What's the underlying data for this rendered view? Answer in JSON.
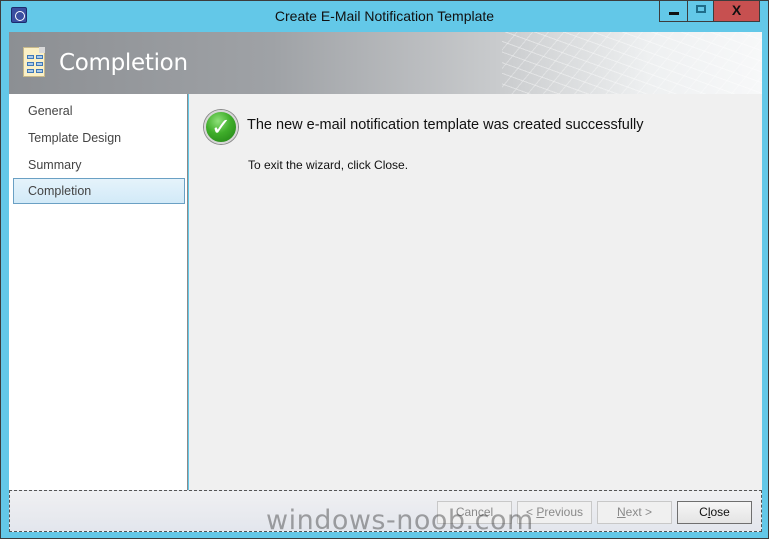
{
  "window": {
    "title": "Create E-Mail Notification Template",
    "controls": {
      "minimize": "minimize",
      "maximize": "maximize",
      "close": "X"
    }
  },
  "header": {
    "title": "Completion",
    "icon": "template-document-icon"
  },
  "sidebar": {
    "items": [
      {
        "label": "General",
        "selected": false
      },
      {
        "label": "Template Design",
        "selected": false
      },
      {
        "label": "Summary",
        "selected": false
      },
      {
        "label": "Completion",
        "selected": true
      }
    ]
  },
  "content": {
    "status_icon": "success-check-icon",
    "success_message": "The new e-mail notification template was created successfully",
    "exit_message": "To exit the wizard, click Close."
  },
  "footer": {
    "buttons": [
      {
        "label": "Cancel",
        "enabled": false
      },
      {
        "label_prefix": "< ",
        "label_mnemonic": "P",
        "label_rest": "revious",
        "enabled": false
      },
      {
        "label_prefix": "",
        "label_mnemonic": "N",
        "label_rest": "ext >",
        "enabled": false
      },
      {
        "label_prefix": "C",
        "label_mnemonic": "l",
        "label_rest": "ose",
        "enabled": true
      }
    ]
  },
  "watermark": "windows-noob.com"
}
